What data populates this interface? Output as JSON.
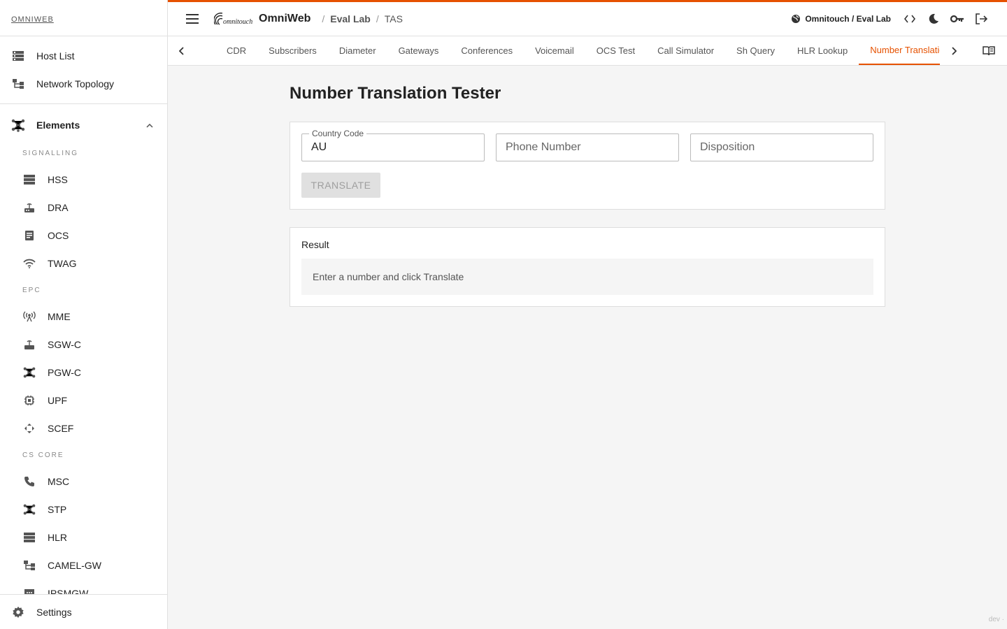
{
  "brand": "OMNIWEB",
  "sidebar": {
    "top_items": [
      {
        "label": "Host List",
        "icon": "list-icon"
      },
      {
        "label": "Network Topology",
        "icon": "topology-icon"
      }
    ],
    "section": {
      "label": "Elements",
      "icon": "hub-icon"
    },
    "groups": [
      {
        "label": "SIGNALLING",
        "items": [
          "HSS",
          "DRA",
          "OCS",
          "TWAG"
        ]
      },
      {
        "label": "EPC",
        "items": [
          "MME",
          "SGW-C",
          "PGW-C",
          "UPF",
          "SCEF"
        ]
      },
      {
        "label": "CS CORE",
        "items": [
          "MSC",
          "STP",
          "HLR",
          "CAMEL-GW",
          "IPSMGW"
        ]
      }
    ],
    "footer": "Settings"
  },
  "header": {
    "app_title": "OmniWeb",
    "breadcrumb": [
      "Eval Lab",
      "TAS"
    ],
    "org": "Omnitouch / Eval Lab",
    "accent": "#e65100"
  },
  "tabs": [
    "CDR",
    "Subscribers",
    "Diameter",
    "Gateways",
    "Conferences",
    "Voicemail",
    "OCS Test",
    "Call Simulator",
    "Sh Query",
    "HLR Lookup",
    "Number Translation"
  ],
  "active_tab": "Number Translation",
  "main": {
    "title": "Number Translation Tester",
    "country_code": {
      "label": "Country Code",
      "value": "AU"
    },
    "phone_number": {
      "placeholder": "Phone Number"
    },
    "disposition": {
      "placeholder": "Disposition"
    },
    "translate_label": "TRANSLATE",
    "result_title": "Result",
    "result_text": "Enter a number and click Translate"
  },
  "dev_tag": "dev ·"
}
